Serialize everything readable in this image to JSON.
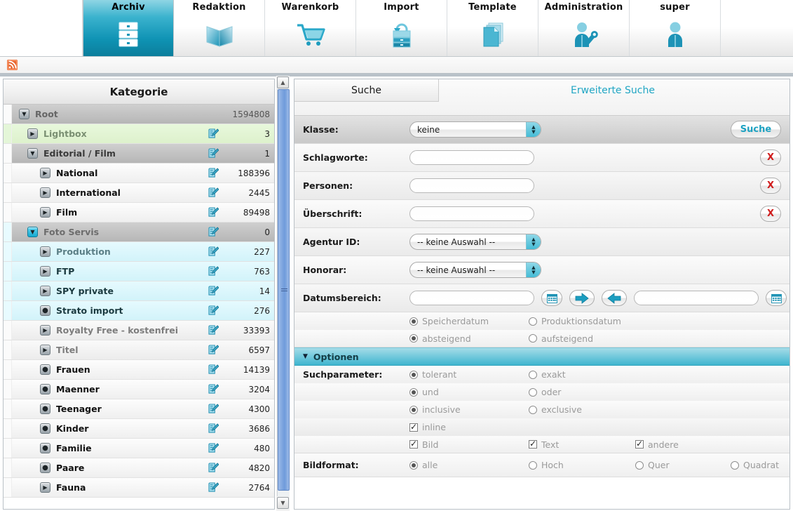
{
  "topnav": {
    "tabs": [
      {
        "label": "Archiv",
        "icon": "archive-cabinet-icon",
        "active": true
      },
      {
        "label": "Redaktion",
        "icon": "open-book-icon",
        "active": false
      },
      {
        "label": "Warenkorb",
        "icon": "shopping-cart-icon",
        "active": false
      },
      {
        "label": "Import",
        "icon": "import-cabinet-icon",
        "active": false
      },
      {
        "label": "Template",
        "icon": "documents-stack-icon",
        "active": false
      },
      {
        "label": "Administration",
        "icon": "user-wrench-icon",
        "active": false
      },
      {
        "label": "super",
        "icon": "user-icon",
        "active": false
      }
    ]
  },
  "rss": {
    "icon": "rss-feed-icon",
    "color": "#e8622a"
  },
  "sidebar": {
    "header": "Kategorie",
    "scrollbar": {
      "up": "▲",
      "down": "▼"
    },
    "items": [
      {
        "label": "Root",
        "count": "1594808",
        "indent": 1,
        "style": "r-root",
        "expander": "down",
        "edit": false
      },
      {
        "label": "Lightbox",
        "count": "3",
        "indent": 2,
        "style": "r-green",
        "expander": "right",
        "edit": true
      },
      {
        "label": "Editorial / Film",
        "count": "1",
        "indent": 2,
        "style": "r-sel",
        "expander": "down",
        "edit": true
      },
      {
        "label": "National",
        "count": "188396",
        "indent": 3,
        "style": "r-plain",
        "expander": "right",
        "edit": true
      },
      {
        "label": "International",
        "count": "2445",
        "indent": 3,
        "style": "r-plain",
        "expander": "right",
        "edit": true
      },
      {
        "label": "Film",
        "count": "89498",
        "indent": 3,
        "style": "r-plain",
        "expander": "right",
        "edit": true
      },
      {
        "label": "Foto Servis",
        "count": "0",
        "indent": 2,
        "style": "r-fotoservis",
        "expander": "down-cyan",
        "edit": true
      },
      {
        "label": "Produktion",
        "count": "227",
        "indent": 3,
        "style": "r-cyan",
        "expander": "right",
        "edit": true
      },
      {
        "label": "FTP",
        "count": "763",
        "indent": 3,
        "style": "r-cyan r-cyan-dark",
        "expander": "right",
        "edit": true
      },
      {
        "label": "SPY private",
        "count": "14",
        "indent": 3,
        "style": "r-cyan r-cyan-dark",
        "expander": "right",
        "edit": true
      },
      {
        "label": "Strato import",
        "count": "276",
        "indent": 3,
        "style": "r-cyan r-cyan-dark",
        "expander": "dot",
        "edit": true
      },
      {
        "label": "Royalty Free - kostenfrei",
        "count": "33393",
        "indent": 3,
        "style": "r-grey",
        "expander": "right",
        "edit": true
      },
      {
        "label": "Titel",
        "count": "6597",
        "indent": 3,
        "style": "r-grey",
        "expander": "right",
        "edit": true
      },
      {
        "label": "Frauen",
        "count": "14139",
        "indent": 3,
        "style": "r-plain",
        "expander": "dot",
        "edit": true
      },
      {
        "label": "Maenner",
        "count": "3204",
        "indent": 3,
        "style": "r-plain",
        "expander": "dot",
        "edit": true
      },
      {
        "label": "Teenager",
        "count": "4300",
        "indent": 3,
        "style": "r-plain",
        "expander": "dot",
        "edit": true
      },
      {
        "label": "Kinder",
        "count": "3686",
        "indent": 3,
        "style": "r-plain",
        "expander": "dot",
        "edit": true
      },
      {
        "label": "Familie",
        "count": "480",
        "indent": 3,
        "style": "r-plain",
        "expander": "dot",
        "edit": true
      },
      {
        "label": "Paare",
        "count": "4820",
        "indent": 3,
        "style": "r-plain",
        "expander": "dot",
        "edit": true
      },
      {
        "label": "Fauna",
        "count": "2764",
        "indent": 3,
        "style": "r-plain",
        "expander": "right",
        "edit": true
      }
    ]
  },
  "search": {
    "tabs": {
      "simple": "Suche",
      "advanced": "Erweiterte Suche"
    },
    "klasse": {
      "label": "Klasse:",
      "value": "keine"
    },
    "submit_label": "Suche",
    "clear_label": "X",
    "fields": [
      {
        "label": "Schlagworte:",
        "value": "",
        "placeholder": "",
        "type": "text",
        "clear": true
      },
      {
        "label": "Personen:",
        "value": "",
        "placeholder": "",
        "type": "text",
        "clear": true
      },
      {
        "label": "Überschrift:",
        "value": "",
        "placeholder": "",
        "type": "text",
        "clear": true
      },
      {
        "label": "Agentur ID:",
        "value": "-- keine Auswahl --",
        "type": "select",
        "clear": false
      },
      {
        "label": "Honorar:",
        "value": "-- keine Auswahl --",
        "type": "select",
        "clear": false
      }
    ],
    "daterange": {
      "label": "Datumsbereich:",
      "from_value": "",
      "to_value": "",
      "calendar_icon": "calendar-icon",
      "forward_icon": "arrow-right-icon",
      "back_icon": "arrow-left-icon",
      "clear_label": "X",
      "date_type": [
        {
          "label": "Speicherdatum",
          "checked": true
        },
        {
          "label": "Produktionsdatum",
          "checked": false
        }
      ],
      "sort_order": [
        {
          "label": "absteigend",
          "checked": true
        },
        {
          "label": "aufsteigend",
          "checked": false
        }
      ]
    },
    "options_bar": {
      "label": "Optionen",
      "expanded": true
    },
    "suchparameter": {
      "label": "Suchparameter:",
      "rows": [
        [
          {
            "label": "tolerant",
            "checked": true,
            "type": "radio"
          },
          {
            "label": "exakt",
            "checked": false,
            "type": "radio"
          }
        ],
        [
          {
            "label": "und",
            "checked": true,
            "type": "radio"
          },
          {
            "label": "oder",
            "checked": false,
            "type": "radio"
          }
        ],
        [
          {
            "label": "inclusive",
            "checked": true,
            "type": "radio"
          },
          {
            "label": "exclusive",
            "checked": false,
            "type": "radio"
          }
        ],
        [
          {
            "label": "inline",
            "checked": true,
            "type": "checkbox"
          }
        ],
        [
          {
            "label": "Bild",
            "checked": true,
            "type": "checkbox"
          },
          {
            "label": "Text",
            "checked": true,
            "type": "checkbox"
          },
          {
            "label": "andere",
            "checked": true,
            "type": "checkbox"
          }
        ]
      ]
    },
    "bildformat": {
      "label": "Bildformat:",
      "options": [
        {
          "label": "alle",
          "checked": true
        },
        {
          "label": "Hoch",
          "checked": false
        },
        {
          "label": "Quer",
          "checked": false
        },
        {
          "label": "Quadrat",
          "checked": false
        }
      ]
    }
  },
  "colors": {
    "accent": "#21a6c4",
    "active_tab": "#0f93b4",
    "options_bar": "#3fb5cf",
    "rss": "#e8622a",
    "clear_x": "#cf1b1b"
  }
}
